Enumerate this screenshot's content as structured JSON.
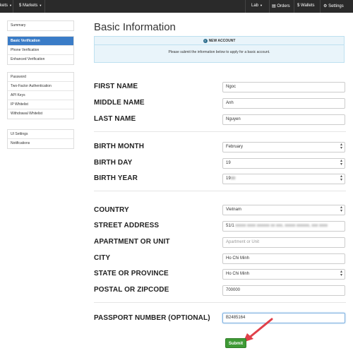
{
  "topnav": {
    "markets_left": "kets",
    "markets": "$ Markets",
    "lab": "Lab",
    "orders": "Orders",
    "wallets": "Wallets",
    "settings": "Settings"
  },
  "sidebar": {
    "groups": [
      [
        "Summary"
      ],
      [
        "Basic Verification",
        "Phone Verification",
        "Enhanced Verification"
      ],
      [
        "Password",
        "Two-Factor Authentication",
        "API Keys",
        "IP Whitelist",
        "Withdrawal Whitelist"
      ],
      [
        "UI Settings",
        "Notifications"
      ]
    ]
  },
  "main": {
    "title": "Basic Information",
    "alert_title": "NEW ACCOUNT",
    "alert_text": "Please submit the information below to apply for a basic account."
  },
  "form": {
    "first_name": {
      "label": "FIRST NAME",
      "value": "Ngoc"
    },
    "middle_name": {
      "label": "MIDDLE NAME",
      "value": "Anh"
    },
    "last_name": {
      "label": "LAST NAME",
      "value": "Nguyen"
    },
    "birth_month": {
      "label": "BIRTH MONTH",
      "value": "February"
    },
    "birth_day": {
      "label": "BIRTH DAY",
      "value": "19"
    },
    "birth_year": {
      "label": "BIRTH YEAR",
      "value": "19"
    },
    "country": {
      "label": "COUNTRY",
      "value": "Vietnam"
    },
    "street_address": {
      "label": "STREET ADDRESS",
      "value": "51/1"
    },
    "apartment": {
      "label": "APARTMENT OR UNIT",
      "placeholder": "Apartment or Unit"
    },
    "city": {
      "label": "CITY",
      "value": "Ho Chi Minh"
    },
    "state": {
      "label": "STATE OR PROVINCE",
      "value": "Ho Chi Minh"
    },
    "postal": {
      "label": "POSTAL OR ZIPCODE",
      "value": "700000"
    },
    "passport": {
      "label": "PASSPORT NUMBER (OPTIONAL)",
      "value": "B2485164"
    },
    "submit": "Submit"
  },
  "colors": {
    "nav_bg": "#2a2a2a",
    "active_item": "#3a7cc7",
    "alert_bg": "#e9f4fa",
    "submit_bg": "#3e9a35",
    "annotation_arrow": "#e0404a"
  }
}
